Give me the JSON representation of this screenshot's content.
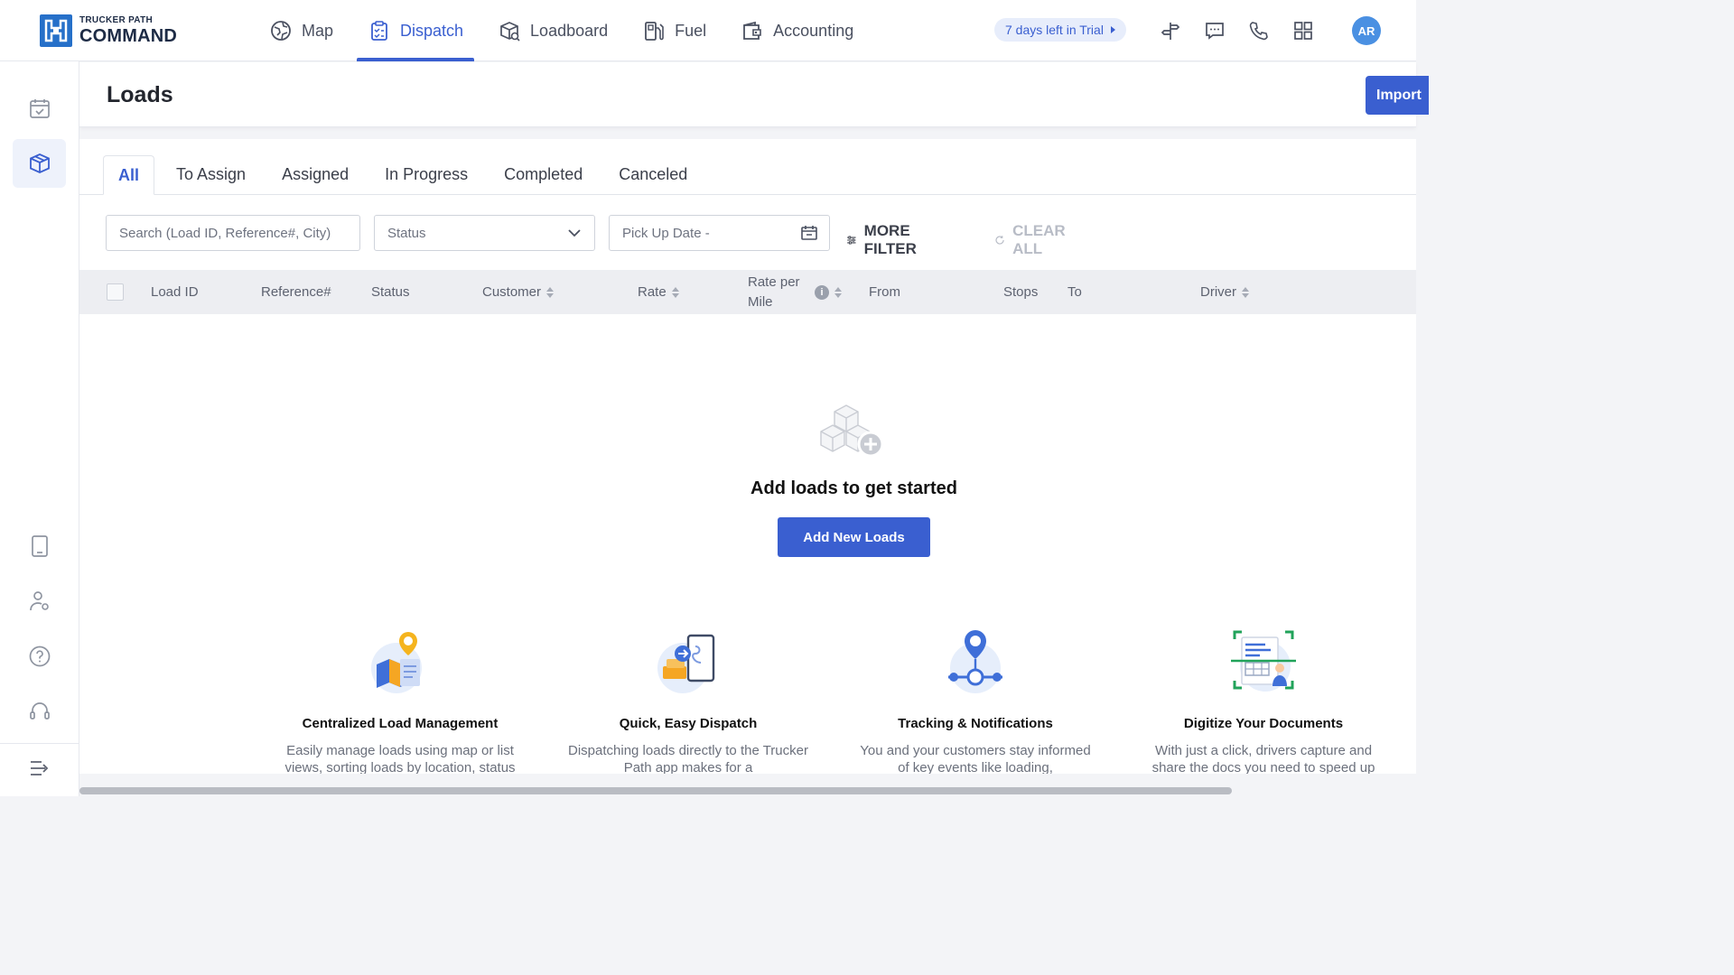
{
  "brand": {
    "small": "TRUCKER PATH",
    "big": "COMMAND"
  },
  "nav": [
    {
      "label": "Map",
      "icon": "map-globe-icon"
    },
    {
      "label": "Dispatch",
      "icon": "clipboard-icon",
      "active": true
    },
    {
      "label": "Loadboard",
      "icon": "loadboard-box-icon"
    },
    {
      "label": "Fuel",
      "icon": "fuel-pump-icon"
    },
    {
      "label": "Accounting",
      "icon": "wallet-icon"
    }
  ],
  "trial": "7 days left in Trial",
  "user": {
    "initials": "AR"
  },
  "page": {
    "title": "Loads",
    "import_label": "Import"
  },
  "tabs": [
    "All",
    "To Assign",
    "Assigned",
    "In Progress",
    "Completed",
    "Canceled"
  ],
  "filters": {
    "search_placeholder": "Search (Load ID, Reference#, City)",
    "status_placeholder": "Status",
    "pickup_placeholder": "Pick Up Date -",
    "more_filter": "MORE FILTER",
    "clear_all": "CLEAR ALL"
  },
  "table": {
    "columns": [
      "Load ID",
      "Reference#",
      "Status",
      "Customer",
      "Rate",
      "Rate per Mile",
      "From",
      "Stops",
      "To",
      "Driver"
    ]
  },
  "empty": {
    "title": "Add loads to get started",
    "button": "Add New Loads"
  },
  "features": [
    {
      "title": "Centralized Load Management",
      "desc": "Easily manage loads using map or list views, sorting loads by location, status"
    },
    {
      "title": "Quick, Easy Dispatch",
      "desc": "Dispatching loads directly to the Trucker Path app makes for a"
    },
    {
      "title": "Tracking & Notifications",
      "desc": "You and your customers stay informed of key events like loading,"
    },
    {
      "title": "Digitize Your Documents",
      "desc": "With just a click, drivers capture and share the docs you need to speed up"
    }
  ],
  "colors": {
    "accent": "#3a5fd0",
    "brand": "#2670c9",
    "avatar": "#4a90e2"
  }
}
